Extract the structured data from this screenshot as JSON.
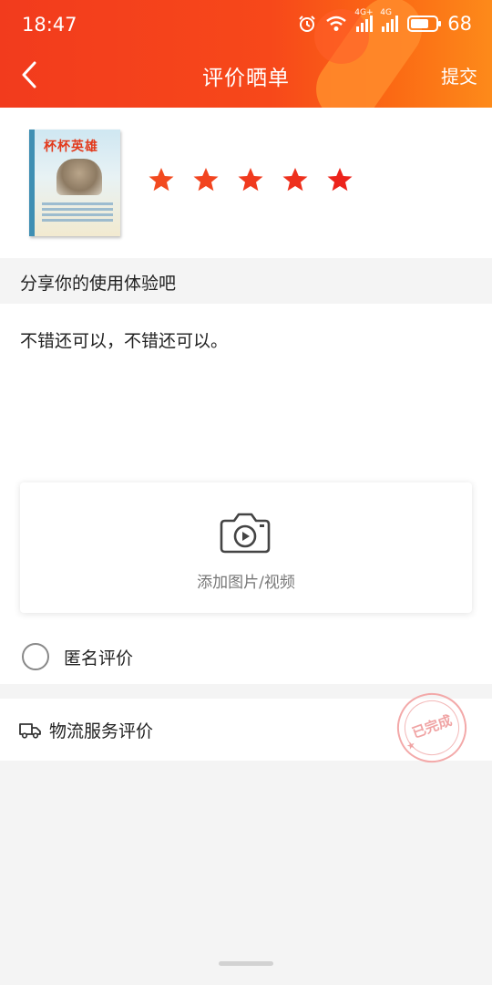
{
  "status_bar": {
    "time": "18:47",
    "network_1": "4G+",
    "network_2": "4G",
    "battery": "68",
    "battery_level": 0.68
  },
  "nav": {
    "title": "评价晒单",
    "submit_label": "提交",
    "back_icon": "chevron-left-icon"
  },
  "product": {
    "book_title": "杯杯英雄",
    "rating": 5,
    "rating_max": 5,
    "star_color": "#f23d1e"
  },
  "review": {
    "section_label": "分享你的使用体验吧",
    "text": "不错还可以，不错还可以。",
    "media_label": "添加图片/视频",
    "media_icon": "camera-video-icon",
    "anonymous_label": "匿名评价"
  },
  "logistics": {
    "label": "物流服务评价",
    "icon": "truck-icon"
  },
  "stamp": {
    "text": "已完成"
  },
  "colors": {
    "header_start": "#f23b1d",
    "header_end": "#fd8a1a",
    "background": "#f4f4f4"
  }
}
